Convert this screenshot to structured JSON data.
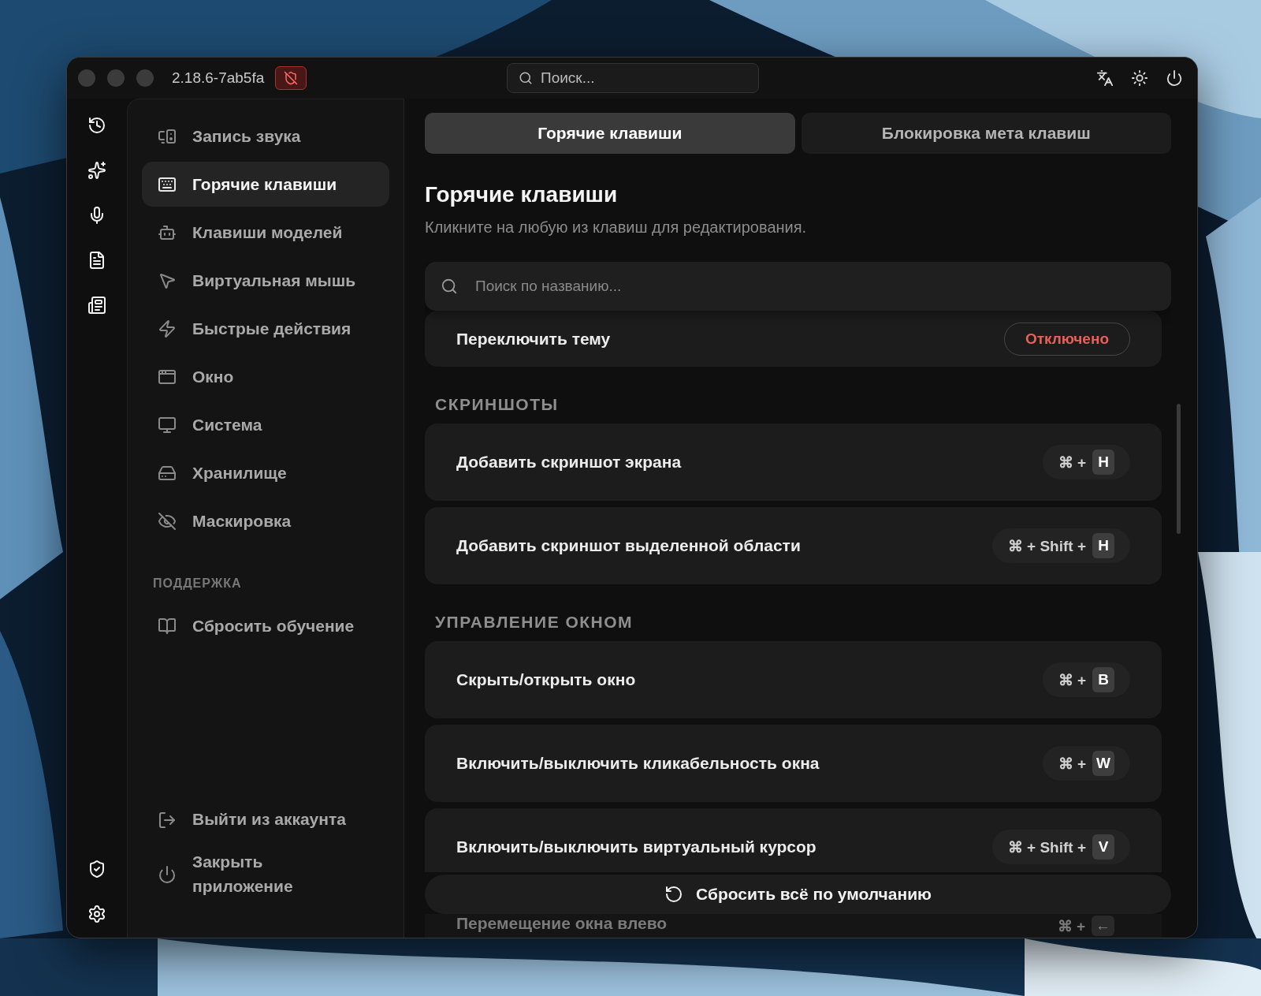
{
  "window": {
    "version": "2.18.6-7ab5fa",
    "search_placeholder": "Поиск..."
  },
  "sidebar": {
    "items": [
      {
        "label": "Запись звука",
        "selected": false
      },
      {
        "label": "Горячие клавиши",
        "selected": true
      },
      {
        "label": "Клавиши моделей",
        "selected": false
      },
      {
        "label": "Виртуальная мышь",
        "selected": false
      },
      {
        "label": "Быстрые действия",
        "selected": false
      },
      {
        "label": "Окно",
        "selected": false
      },
      {
        "label": "Система",
        "selected": false
      },
      {
        "label": "Хранилище",
        "selected": false
      },
      {
        "label": "Маскировка",
        "selected": false
      }
    ],
    "support_heading": "ПОДДЕРЖКА",
    "support_items": [
      {
        "label": "Сбросить обучение"
      }
    ],
    "footer_items": [
      {
        "label": "Выйти из аккаунта"
      },
      {
        "label": "Закрыть приложение"
      }
    ]
  },
  "tabs": [
    {
      "label": "Горячие клавиши",
      "selected": true
    },
    {
      "label": "Блокировка мета клавиш",
      "selected": false
    }
  ],
  "heading": "Горячие клавиши",
  "subtitle": "Кликните на любую из клавиш для редактирования.",
  "search": {
    "placeholder": "Поиск по названию..."
  },
  "groups": [
    {
      "rows": [
        {
          "label": "Переключить тему",
          "kind": "status",
          "status": "Отключено"
        }
      ]
    },
    {
      "title": "СКРИНШОТЫ",
      "rows": [
        {
          "label": "Добавить скриншот экрана",
          "kind": "shortcut",
          "modifiers": "⌘ +",
          "key": "H"
        },
        {
          "label": "Добавить скриншот выделенной области",
          "kind": "shortcut",
          "modifiers": "⌘ + Shift +",
          "key": "H"
        }
      ]
    },
    {
      "title": "УПРАВЛЕНИЕ ОКНОМ",
      "rows": [
        {
          "label": "Скрыть/открыть окно",
          "kind": "shortcut",
          "modifiers": "⌘ +",
          "key": "B"
        },
        {
          "label": "Включить/выключить кликабельность окна",
          "kind": "shortcut",
          "modifiers": "⌘ +",
          "key": "W"
        },
        {
          "label": "Включить/выключить виртуальный курсор",
          "kind": "shortcut",
          "modifiers": "⌘ + Shift +",
          "key": "V"
        },
        {
          "label": "Перемещение окна влево",
          "kind": "shortcut",
          "modifiers": "⌘ +",
          "key": "←"
        }
      ]
    }
  ],
  "reset_button": "Сбросить всё по умолчанию"
}
